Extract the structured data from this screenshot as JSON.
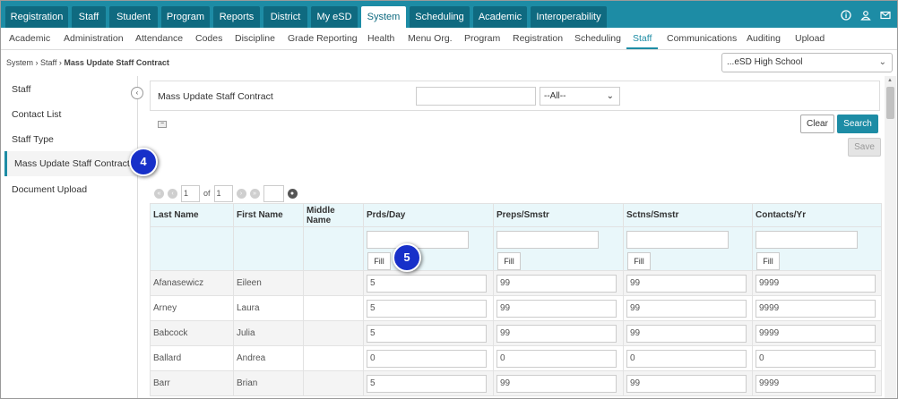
{
  "top_nav": [
    "Registration",
    "Staff",
    "Student",
    "Program",
    "Reports",
    "District",
    "My eSD",
    "System",
    "Scheduling",
    "Academic",
    "Interoperability"
  ],
  "top_nav_active": "System",
  "top_icons": [
    "info-icon",
    "user-icon",
    "mail-icon"
  ],
  "sub_nav": [
    "Academic",
    "Administration",
    "Attendance",
    "Codes",
    "Discipline",
    "Grade Reporting",
    "Health",
    "Menu Org.",
    "Program",
    "Registration",
    "Scheduling",
    "Staff",
    "Communications",
    "Auditing",
    "Upload"
  ],
  "sub_nav_active": "Staff",
  "breadcrumb": {
    "c1": "System",
    "c2": "Staff",
    "c3": "Mass Update Staff Contract"
  },
  "school_select": "...eSD High School",
  "sidebar": [
    "Staff",
    "Contact List",
    "Staff Type",
    "Mass Update Staff Contract",
    "Document Upload"
  ],
  "panel": {
    "title": "Mass Update Staff Contract",
    "filter_value": "",
    "dropdown_value": "--All--"
  },
  "buttons": {
    "clear": "Clear",
    "search": "Search",
    "save": "Save",
    "fill": "Fill"
  },
  "pager": {
    "page": "1",
    "of_label": "of",
    "total": "1",
    "size": ""
  },
  "badges": {
    "b4": "4",
    "b5": "5"
  },
  "table": {
    "columns": [
      "Last Name",
      "First Name",
      "Middle Name",
      "Prds/Day",
      "Preps/Smstr",
      "Sctns/Smstr",
      "Contacts/Yr"
    ],
    "rows": [
      {
        "last": "Afanasewicz",
        "first": "Eileen",
        "middle": "",
        "prds": "5",
        "preps": "99",
        "sctns": "99",
        "contacts": "9999"
      },
      {
        "last": "Arney",
        "first": "Laura",
        "middle": "",
        "prds": "5",
        "preps": "99",
        "sctns": "99",
        "contacts": "9999"
      },
      {
        "last": "Babcock",
        "first": "Julia",
        "middle": "",
        "prds": "5",
        "preps": "99",
        "sctns": "99",
        "contacts": "9999"
      },
      {
        "last": "Ballard",
        "first": "Andrea",
        "middle": "",
        "prds": "0",
        "preps": "0",
        "sctns": "0",
        "contacts": "0"
      },
      {
        "last": "Barr",
        "first": "Brian",
        "middle": "",
        "prds": "5",
        "preps": "99",
        "sctns": "99",
        "contacts": "9999"
      }
    ]
  }
}
